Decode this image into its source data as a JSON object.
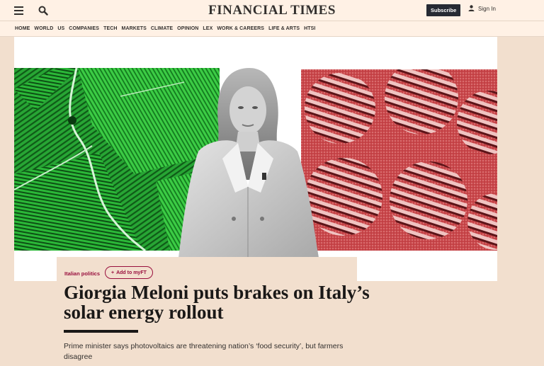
{
  "header": {
    "masthead": "FINANCIAL TIMES",
    "subscribe_label": "Subscribe",
    "signin_label": "Sign In",
    "icons": [
      "menu-icon",
      "search-icon",
      "user-icon"
    ]
  },
  "nav": {
    "items": [
      "HOME",
      "WORLD",
      "US",
      "COMPANIES",
      "TECH",
      "MARKETS",
      "CLIMATE",
      "OPINION",
      "LEX",
      "WORK & CAREERS",
      "LIFE & ARTS",
      "HTSI"
    ]
  },
  "article": {
    "tag": "Italian politics",
    "myft_label": "Add to myFT",
    "headline": "Giorgia Meloni puts brakes on Italy’s solar energy rollout",
    "standfirst": "Prime minister says photovoltaics are threatening nation’s ‘food security’, but farmers disagree"
  },
  "colors": {
    "page_bg": "#f2dfce",
    "header_bg": "#fff1e5",
    "claret": "#990f3d",
    "subscribe_bg": "#262a33",
    "farmland_green": "#2dbf3b",
    "solar_red": "#c9464a"
  }
}
